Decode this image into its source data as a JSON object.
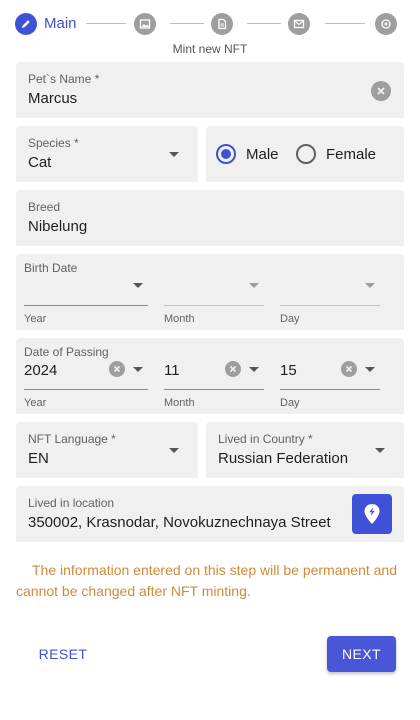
{
  "stepper": {
    "active_label": "Main",
    "subtitle": "Mint new NFT",
    "steps": [
      {
        "icon": "pencil-icon",
        "state": "active"
      },
      {
        "icon": "image-icon",
        "state": "inactive"
      },
      {
        "icon": "document-icon",
        "state": "inactive"
      },
      {
        "icon": "envelope-icon",
        "state": "inactive"
      },
      {
        "icon": "nft-coin-icon",
        "state": "inactive"
      }
    ]
  },
  "form": {
    "pet_name": {
      "label": "Pet`s Name *",
      "value": "Marcus"
    },
    "species": {
      "label": "Species *",
      "value": "Cat"
    },
    "gender": {
      "options": [
        "Male",
        "Female"
      ],
      "selected": "Male"
    },
    "breed": {
      "label": "Breed",
      "value": "Nibelung"
    },
    "birth_date": {
      "label": "Birth Date",
      "year": {
        "label": "Year",
        "value": ""
      },
      "month": {
        "label": "Month",
        "value": ""
      },
      "day": {
        "label": "Day",
        "value": ""
      }
    },
    "passing_date": {
      "label": "Date of Passing",
      "year": {
        "label": "Year",
        "value": "2024"
      },
      "month": {
        "label": "Month",
        "value": "11"
      },
      "day": {
        "label": "Day",
        "value": "15"
      }
    },
    "nft_language": {
      "label": "NFT Language *",
      "value": "EN"
    },
    "country": {
      "label": "Lived in Country *",
      "value": "Russian Federation"
    },
    "location": {
      "label": "Lived in location",
      "value": "350002, Krasnodar, Novokuznechnaya Street"
    }
  },
  "warning": "The information entered on this step will be permanent and cannot be changed after NFT minting.",
  "actions": {
    "reset_label": "RESET",
    "next_label": "NEXT"
  },
  "colors": {
    "primary": "#3f51d6",
    "warning": "#d08a3a",
    "field_bg": "#f0f0f0"
  }
}
